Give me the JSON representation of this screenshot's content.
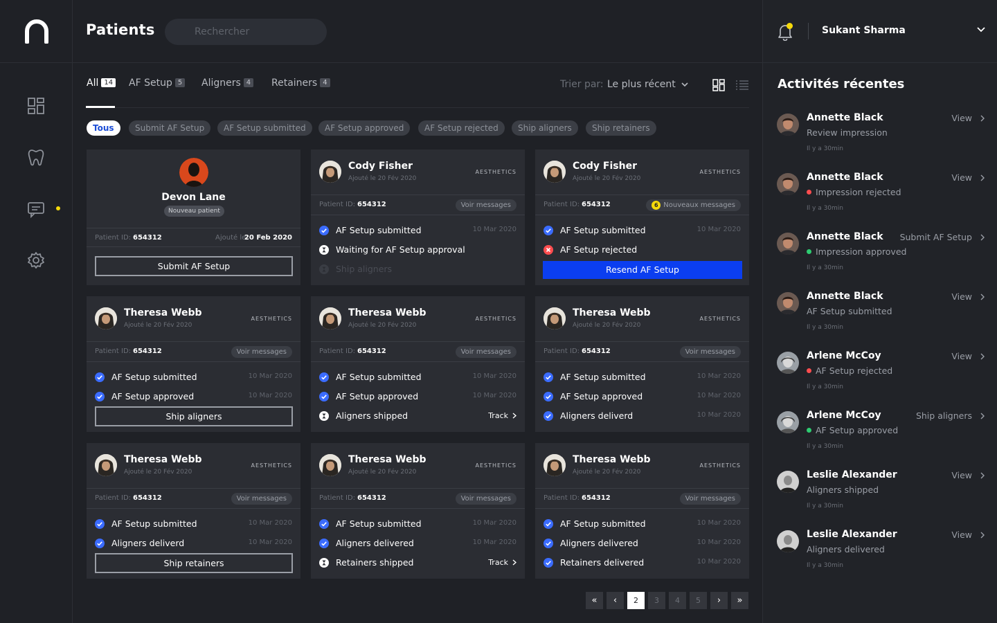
{
  "header": {
    "title": "Patients",
    "search_placeholder": "Rechercher"
  },
  "user": {
    "name": "Sukant Sharma"
  },
  "tabs": [
    {
      "label": "All",
      "count": "14",
      "active": true
    },
    {
      "label": "AF Setup",
      "count": "5"
    },
    {
      "label": "Aligners",
      "count": "4"
    },
    {
      "label": "Retainers",
      "count": "4"
    }
  ],
  "sort": {
    "label": "Trier par:",
    "value": "Le plus récent"
  },
  "filters": [
    "Tous",
    "Submit AF Setup",
    "AF Setup submitted",
    "AF Setup approved",
    "AF Setup rejected",
    "Ship aligners",
    "Ship retainers"
  ],
  "new_patient": {
    "name": "Devon Lane",
    "badge": "Nouveau patient",
    "id_label": "Patient ID:",
    "id": "654312",
    "added_label": "Ajouté le:",
    "added": "20 Feb 2020",
    "button": "Submit AF Setup"
  },
  "cards": [
    {
      "name": "Cody Fisher",
      "date": "Ajouté le 20 Fév 2020",
      "tag": "AESTHETICS",
      "id_label": "Patient ID:",
      "id": "654312",
      "messages": "Voir messages",
      "badge": "",
      "statuses": [
        {
          "label": "AF Setup submitted",
          "date": "10 Mar 2020",
          "state": "done"
        },
        {
          "label": "Waiting for AF Setup approval",
          "date": "",
          "state": "pending"
        },
        {
          "label": "Ship aligners",
          "date": "",
          "state": "future"
        }
      ],
      "button": "",
      "button_style": ""
    },
    {
      "name": "Cody Fisher",
      "date": "Ajouté le 20 Fév 2020",
      "tag": "AESTHETICS",
      "id_label": "Patient ID:",
      "id": "654312",
      "messages": "Nouveaux messages",
      "badge": "6",
      "statuses": [
        {
          "label": "AF Setup submitted",
          "date": "10 Mar 2020",
          "state": "done"
        },
        {
          "label": "AF Setup rejected",
          "date": "",
          "state": "rejected"
        }
      ],
      "button": "Resend AF Setup",
      "button_style": "blue"
    },
    {
      "name": "Theresa Webb",
      "date": "Ajouté le 20 Fév 2020",
      "tag": "AESTHETICS",
      "id_label": "Patient ID:",
      "id": "654312",
      "messages": "Voir messages",
      "badge": "",
      "statuses": [
        {
          "label": "AF Setup submitted",
          "date": "10 Mar 2020",
          "state": "done"
        },
        {
          "label": "AF Setup approved",
          "date": "10 Mar 2020",
          "state": "done"
        }
      ],
      "button": "Ship aligners",
      "button_style": "outline"
    },
    {
      "name": "Theresa Webb",
      "date": "Ajouté le 20 Fév 2020",
      "tag": "AESTHETICS",
      "id_label": "Patient ID:",
      "id": "654312",
      "messages": "Voir messages",
      "badge": "",
      "statuses": [
        {
          "label": "AF Setup submitted",
          "date": "10 Mar 2020",
          "state": "done"
        },
        {
          "label": "AF Setup approved",
          "date": "10 Mar 2020",
          "state": "done"
        },
        {
          "label": "Aligners shipped",
          "date": "",
          "state": "pending",
          "track": "Track"
        }
      ],
      "button": "",
      "button_style": ""
    },
    {
      "name": "Theresa Webb",
      "date": "Ajouté le 20 Fév 2020",
      "tag": "AESTHETICS",
      "id_label": "Patient ID:",
      "id": "654312",
      "messages": "Voir messages",
      "badge": "",
      "statuses": [
        {
          "label": "AF Setup submitted",
          "date": "10 Mar 2020",
          "state": "done"
        },
        {
          "label": "AF Setup approved",
          "date": "10 Mar 2020",
          "state": "done"
        },
        {
          "label": "Aligners deliverd",
          "date": "10 Mar 2020",
          "state": "done"
        }
      ],
      "button": "",
      "button_style": ""
    },
    {
      "name": "Theresa Webb",
      "date": "Ajouté le 20 Fév 2020",
      "tag": "AESTHETICS",
      "id_label": "Patient ID:",
      "id": "654312",
      "messages": "Voir messages",
      "badge": "",
      "statuses": [
        {
          "label": "AF Setup submitted",
          "date": "10 Mar 2020",
          "state": "done"
        },
        {
          "label": "Aligners deliverd",
          "date": "10 Mar 2020",
          "state": "done"
        }
      ],
      "button": "Ship retainers",
      "button_style": "outline"
    },
    {
      "name": "Theresa Webb",
      "date": "Ajouté le 20 Fév 2020",
      "tag": "AESTHETICS",
      "id_label": "Patient ID:",
      "id": "654312",
      "messages": "Voir messages",
      "badge": "",
      "statuses": [
        {
          "label": "AF Setup submitted",
          "date": "10 Mar 2020",
          "state": "done"
        },
        {
          "label": "Aligners delivered",
          "date": "10 Mar 2020",
          "state": "done"
        },
        {
          "label": "Retainers shipped",
          "date": "",
          "state": "pending",
          "track": "Track"
        }
      ],
      "button": "",
      "button_style": ""
    },
    {
      "name": "Theresa Webb",
      "date": "Ajouté le 20 Fév 2020",
      "tag": "AESTHETICS",
      "id_label": "Patient ID:",
      "id": "654312",
      "messages": "Voir messages",
      "badge": "",
      "statuses": [
        {
          "label": "AF Setup submitted",
          "date": "10 Mar 2020",
          "state": "done"
        },
        {
          "label": "Aligners delivered",
          "date": "10 Mar 2020",
          "state": "done"
        },
        {
          "label": "Retainers delivered",
          "date": "10 Mar 2020",
          "state": "done"
        }
      ],
      "button": "",
      "button_style": ""
    }
  ],
  "activity": {
    "title": "Activités récentes",
    "items": [
      {
        "name": "Annette Black",
        "status": "Review impression",
        "dot": "",
        "time": "Il y a 30min",
        "action": "View"
      },
      {
        "name": "Annette Black",
        "status": "Impression rejected",
        "dot": "#ff4d4f",
        "time": "Il y a 30min",
        "action": "View"
      },
      {
        "name": "Annette Black",
        "status": "Impression approved",
        "dot": "#2ecc71",
        "time": "Il y a 30min",
        "action": "Submit AF Setup"
      },
      {
        "name": "Annette Black",
        "status": "AF Setup submitted",
        "dot": "",
        "time": "Il y a 30min",
        "action": "View"
      },
      {
        "name": "Arlene McCoy",
        "status": "AF Setup rejected",
        "dot": "#ff4d4f",
        "time": "Il y a 30min",
        "action": "View"
      },
      {
        "name": "Arlene McCoy",
        "status": "AF Setup approved",
        "dot": "#2ecc71",
        "time": "Il y a 30min",
        "action": "Ship aligners"
      },
      {
        "name": "Leslie Alexander",
        "status": "Aligners shipped",
        "dot": "",
        "time": "Il y a 30min",
        "action": "View"
      },
      {
        "name": "Leslie Alexander",
        "status": "Aligners delivered",
        "dot": "",
        "time": "Il y a 30min",
        "action": "View"
      }
    ]
  },
  "pagination": {
    "first": "«",
    "prev": "‹",
    "pages": [
      "2",
      "3",
      "4",
      "5"
    ],
    "current": "2",
    "next": "›",
    "last": "»"
  },
  "colors": {
    "accent": "#0b3ef0",
    "notification": "#f5d90a",
    "done": "#3b6cff",
    "rejected": "#ff4d4f"
  }
}
